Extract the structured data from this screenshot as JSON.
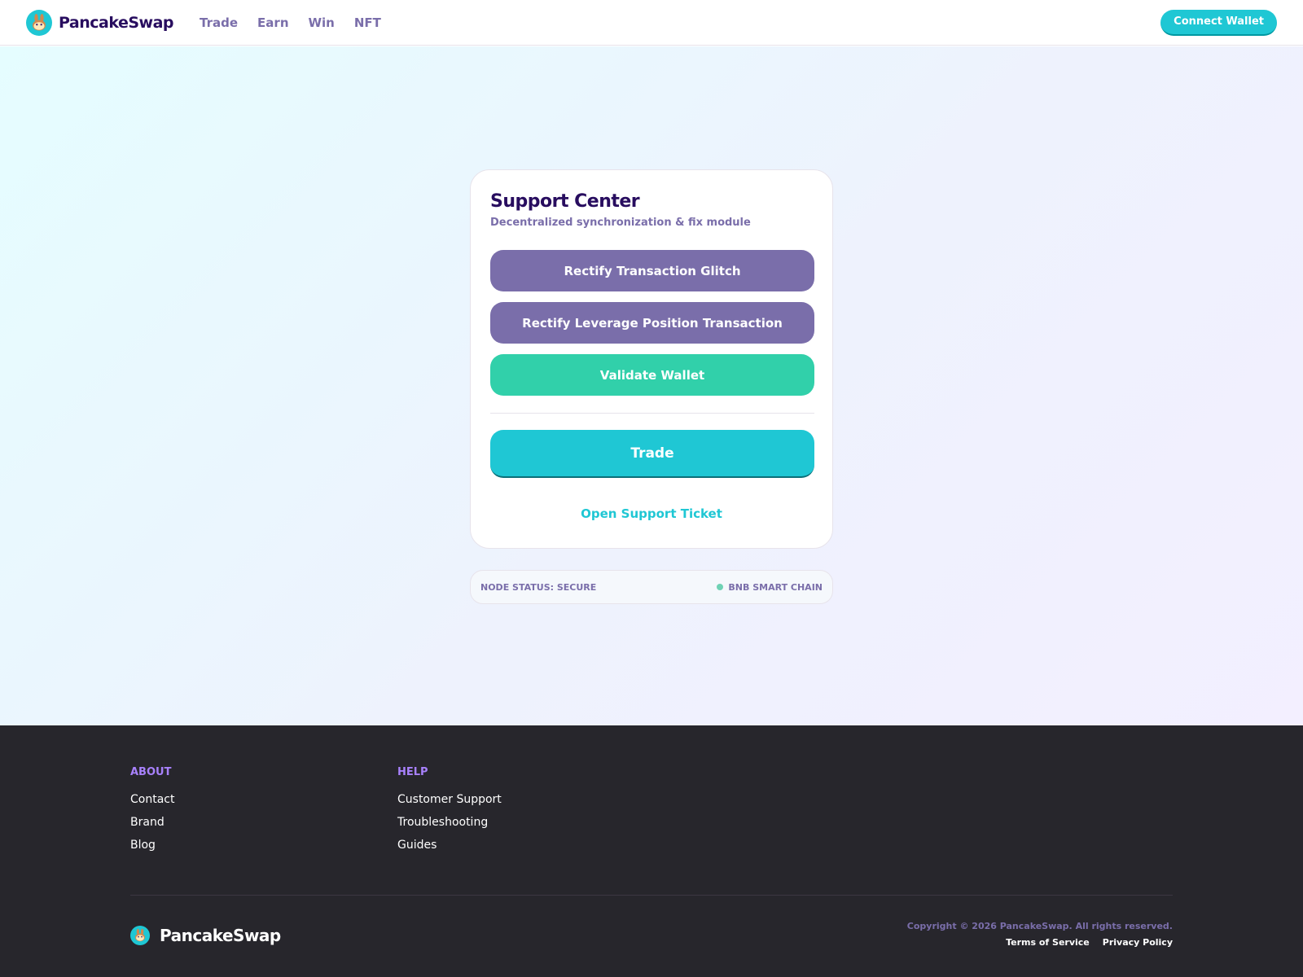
{
  "brand": {
    "name": "PancakeSwap",
    "logo_icon": "bunny-icon",
    "colors": {
      "primary": "#1fc7d4",
      "secondary": "#7a6eaa",
      "success": "#31d0aa",
      "title": "#280d5f",
      "footer_bg": "#27262c",
      "footer_heading": "#a881fc"
    }
  },
  "header": {
    "nav": [
      "Trade",
      "Earn",
      "Win",
      "NFT"
    ],
    "connect_label": "Connect Wallet"
  },
  "card": {
    "title": "Support Center",
    "subtitle": "Decentralized synchronization & fix module",
    "actions": [
      "Rectify Transaction Glitch",
      "Rectify Leverage Position Transaction",
      "Validate Wallet"
    ],
    "trade_label": "Trade",
    "ticket_label": "Open Support Ticket"
  },
  "status": {
    "node_status": "NODE STATUS: SECURE",
    "chain": "BNB SMART CHAIN"
  },
  "footer": {
    "about": {
      "heading": "ABOUT",
      "links": [
        "Contact",
        "Brand",
        "Blog"
      ]
    },
    "help": {
      "heading": "HELP",
      "links": [
        "Customer Support",
        "Troubleshooting",
        "Guides"
      ]
    },
    "brand_name": "PancakeSwap",
    "copyright": "Copyright © 2026 PancakeSwap. All rights reserved.",
    "legal": [
      "Terms of Service",
      "Privacy Policy"
    ]
  }
}
